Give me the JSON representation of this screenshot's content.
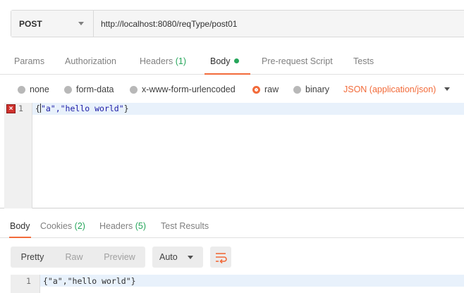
{
  "request": {
    "method": "POST",
    "url": "http://localhost:8080/reqType/post01"
  },
  "request_tabs": {
    "params": "Params",
    "authorization": "Authorization",
    "headers": "Headers",
    "headers_count": "(1)",
    "body": "Body",
    "prerequest": "Pre-request Script",
    "tests": "Tests"
  },
  "body_types": {
    "none": "none",
    "form_data": "form-data",
    "urlencoded": "x-www-form-urlencoded",
    "raw": "raw",
    "binary": "binary",
    "selected": "raw",
    "content_type": "JSON (application/json)"
  },
  "editor": {
    "line_number": "1",
    "code_open": "{",
    "code_content": "\"a\",\"hello world\"",
    "code_close": "}"
  },
  "response_tabs": {
    "body": "Body",
    "cookies": "Cookies",
    "cookies_count": "(2)",
    "headers": "Headers",
    "headers_count": "(5)",
    "test_results": "Test Results"
  },
  "response_toolbar": {
    "pretty": "Pretty",
    "raw": "Raw",
    "preview": "Preview",
    "format": "Auto"
  },
  "response_body": {
    "line_number": "1",
    "code": "{\"a\",\"hello world\"}"
  },
  "colors": {
    "accent": "#f26b3a",
    "count_green": "#26a65b",
    "error_red": "#d0312d",
    "string_blue": "#1a1aa6"
  },
  "icons": {
    "error": "error-x-icon",
    "wrap": "wrap-lines-icon",
    "dropdown": "caret-down-icon"
  }
}
